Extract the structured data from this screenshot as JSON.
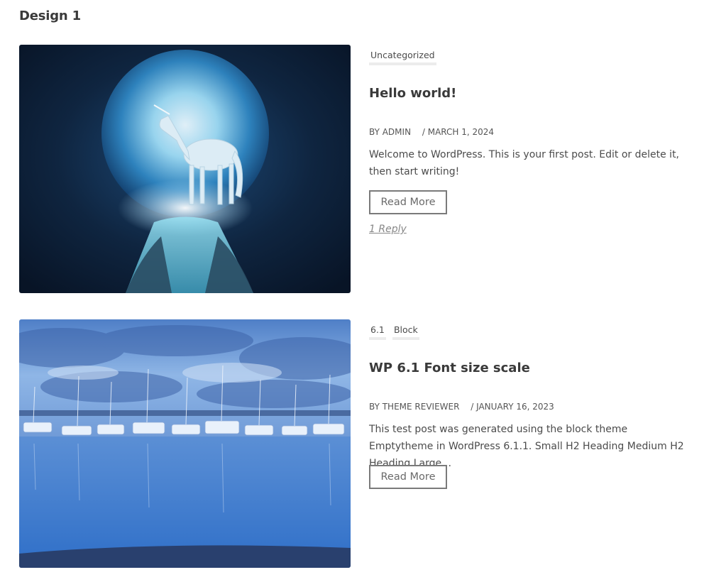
{
  "section_title": "Design 1",
  "posts": [
    {
      "categories": [
        "Uncategorized"
      ],
      "title": "Hello world!",
      "author": "BY ADMIN",
      "date": "/ MARCH 1, 2024",
      "excerpt": "Welcome to WordPress. This is your first post. Edit or delete it, then start writing!",
      "read_more": "Read More",
      "replies": "1 Reply",
      "image": "unicorn-moon-image"
    },
    {
      "categories": [
        "6.1",
        "Block"
      ],
      "title": "WP 6.1 Font size scale",
      "author": "BY THEME REVIEWER",
      "date": "/ JANUARY 16, 2023",
      "excerpt": "This test post was generated using the block theme Emptytheme in WordPress 6.1.1. Small H2 Heading Medium H2 Heading Large…",
      "read_more": "Read More",
      "image": "marina-boats-image"
    }
  ]
}
